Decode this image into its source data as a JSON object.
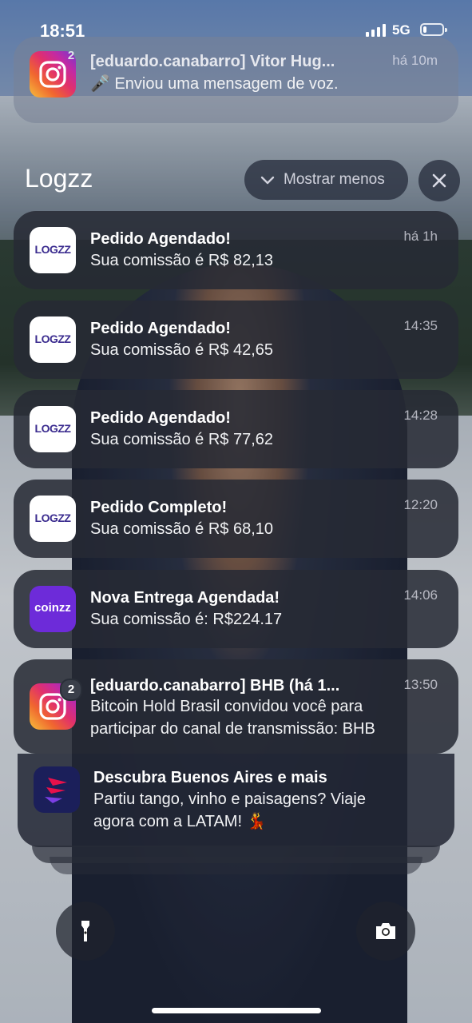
{
  "status_bar": {
    "time": "18:51",
    "network": "5G",
    "battery_level": 0.2
  },
  "top_notification": {
    "app": "Instagram",
    "badge": "2",
    "title": "[eduardo.canabarro] Vitor Hug...",
    "time": "há 10m",
    "message": "🎤 Enviou uma mensagem de voz."
  },
  "group": {
    "name": "Logzz",
    "show_less_label": "Mostrar menos",
    "notifications": [
      {
        "title": "Pedido Agendado!",
        "message": "Sua comissão é R$ 82,13",
        "time": "há 1h",
        "logo": "LOGZZ"
      },
      {
        "title": "Pedido Agendado!",
        "message": "Sua comissão é R$ 42,65",
        "time": "14:35",
        "logo": "LOGZZ"
      },
      {
        "title": "Pedido Agendado!",
        "message": "Sua comissão é R$ 77,62",
        "time": "14:28",
        "logo": "LOGZZ"
      },
      {
        "title": "Pedido Completo!",
        "message": "Sua comissão é R$ 68,10",
        "time": "12:20",
        "logo": "LOGZZ"
      }
    ]
  },
  "coinzz_notification": {
    "title": "Nova Entrega Agendada!",
    "message": "Sua comissão é: R$224.17",
    "time": "14:06",
    "logo": "coinzz"
  },
  "instagram_notification": {
    "badge": "2",
    "title": "[eduardo.canabarro] BHB (há 1...",
    "time": "13:50",
    "message_line1": "Bitcoin Hold Brasil convidou você para",
    "message_line2": "participar do canal de transmissão: BHB"
  },
  "latam_notification": {
    "title": "Descubra Buenos Aires e mais",
    "message_line1": "Partiu tango, vinho e paisagens? Viaje",
    "message_line2": "agora com a LATAM! 💃"
  },
  "colors": {
    "instagram_gradient_end": "#7138d0",
    "coinzz": "#6d2bd9",
    "logzz_text": "#3b2c8f",
    "latam": "#1b1f5a"
  }
}
